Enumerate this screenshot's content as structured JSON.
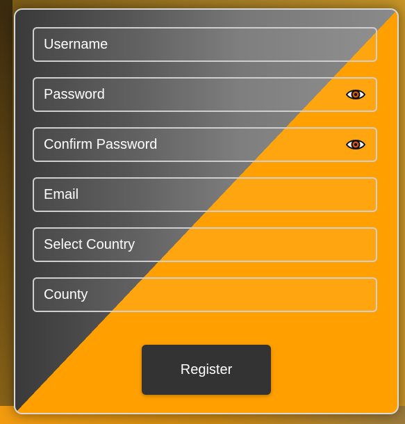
{
  "form": {
    "fields": [
      {
        "label": "Username"
      },
      {
        "label": "Password",
        "icon": "eye-icon"
      },
      {
        "label": "Confirm Password",
        "icon": "eye-icon"
      },
      {
        "label": "Email"
      },
      {
        "label": "Select Country"
      },
      {
        "label": "County"
      }
    ],
    "register_label": "Register"
  },
  "colors": {
    "accent": "#FFA000",
    "card_border": "#D9D9D9",
    "button_bg": "#333333",
    "text": "#FFFFFF"
  }
}
